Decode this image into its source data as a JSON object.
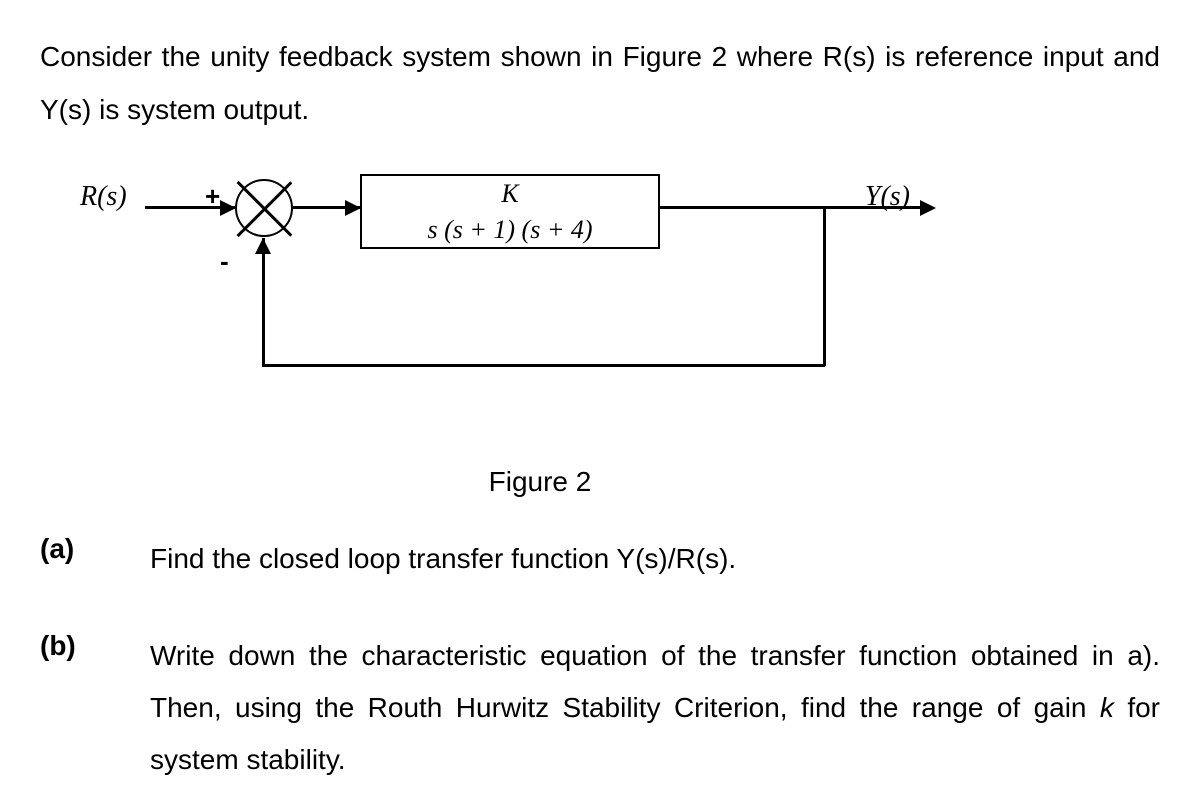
{
  "intro": "Consider the unity feedback system shown in Figure 2 where R(s) is reference input and Y(s) is system output.",
  "diagram": {
    "input_signal": "R(s)",
    "output_signal": "Y(s)",
    "plus": "+",
    "minus": "-",
    "transfer_function": {
      "numerator": "K",
      "denominator": "s (s + 1) (s + 4)"
    }
  },
  "figure_caption": "Figure 2",
  "questions": [
    {
      "label": "(a)",
      "text": "Find the closed loop transfer function Y(s)/R(s)."
    },
    {
      "label": "(b)",
      "text_part1": "Write down the characteristic equation of the transfer function obtained in a). Then, using the Routh Hurwitz Stability Criterion, find the range of gain ",
      "text_italic": "k",
      "text_part2": " for system stability."
    }
  ]
}
